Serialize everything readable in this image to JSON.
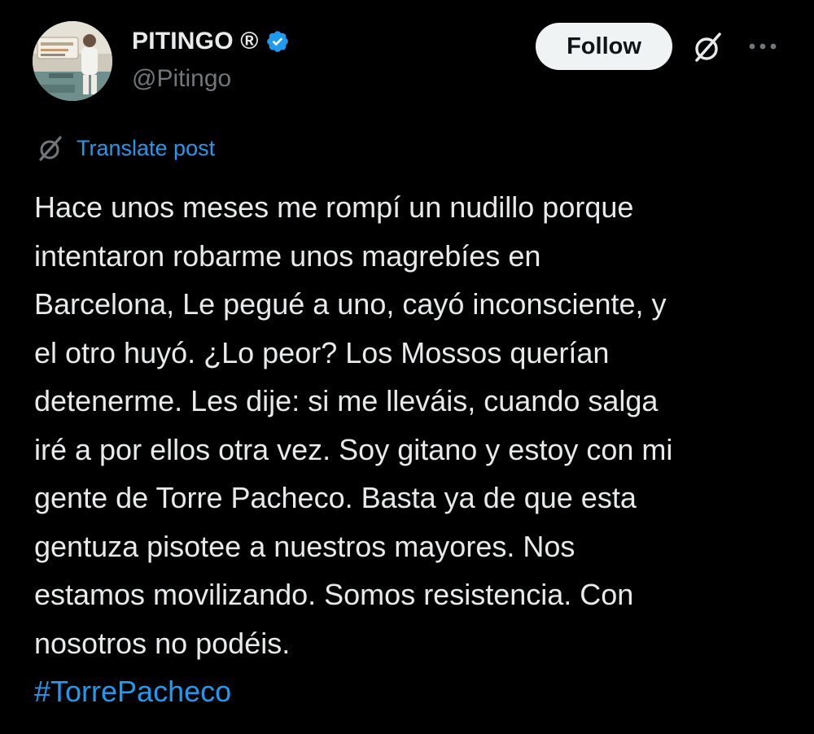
{
  "author": {
    "display_name": "PITINGO ®",
    "handle": "@Pitingo",
    "verified": true,
    "verified_color": "#1d9bf0"
  },
  "actions": {
    "follow_label": "Follow",
    "grok_icon": "grok-icon",
    "more_icon": "more-horizontal-icon"
  },
  "translate": {
    "label": "Translate post",
    "icon": "grok-translate-icon"
  },
  "post": {
    "lines": [
      "Hace unos meses me rompí un nudillo porque",
      "intentaron robarme unos magrebíes en",
      "Barcelona, Le pegué a uno, cayó inconsciente, y",
      "el otro huyó. ¿Lo peor? Los Mossos querían",
      "detenerme. Les dije: si me lleváis, cuando salga",
      "iré a por ellos otra vez. Soy gitano y estoy con mi",
      "gente de Torre Pacheco. Basta ya de que esta",
      "gentuza pisotee a nuestros mayores. Nos",
      "estamos movilizando. Somos resistencia. Con",
      "nosotros no podéis."
    ],
    "hashtag": "#TorrePacheco"
  },
  "colors": {
    "background": "#000000",
    "text": "#e7e9ea",
    "secondary": "#71767b",
    "accent": "#1d9bf0",
    "button_bg": "#eff3f4"
  }
}
